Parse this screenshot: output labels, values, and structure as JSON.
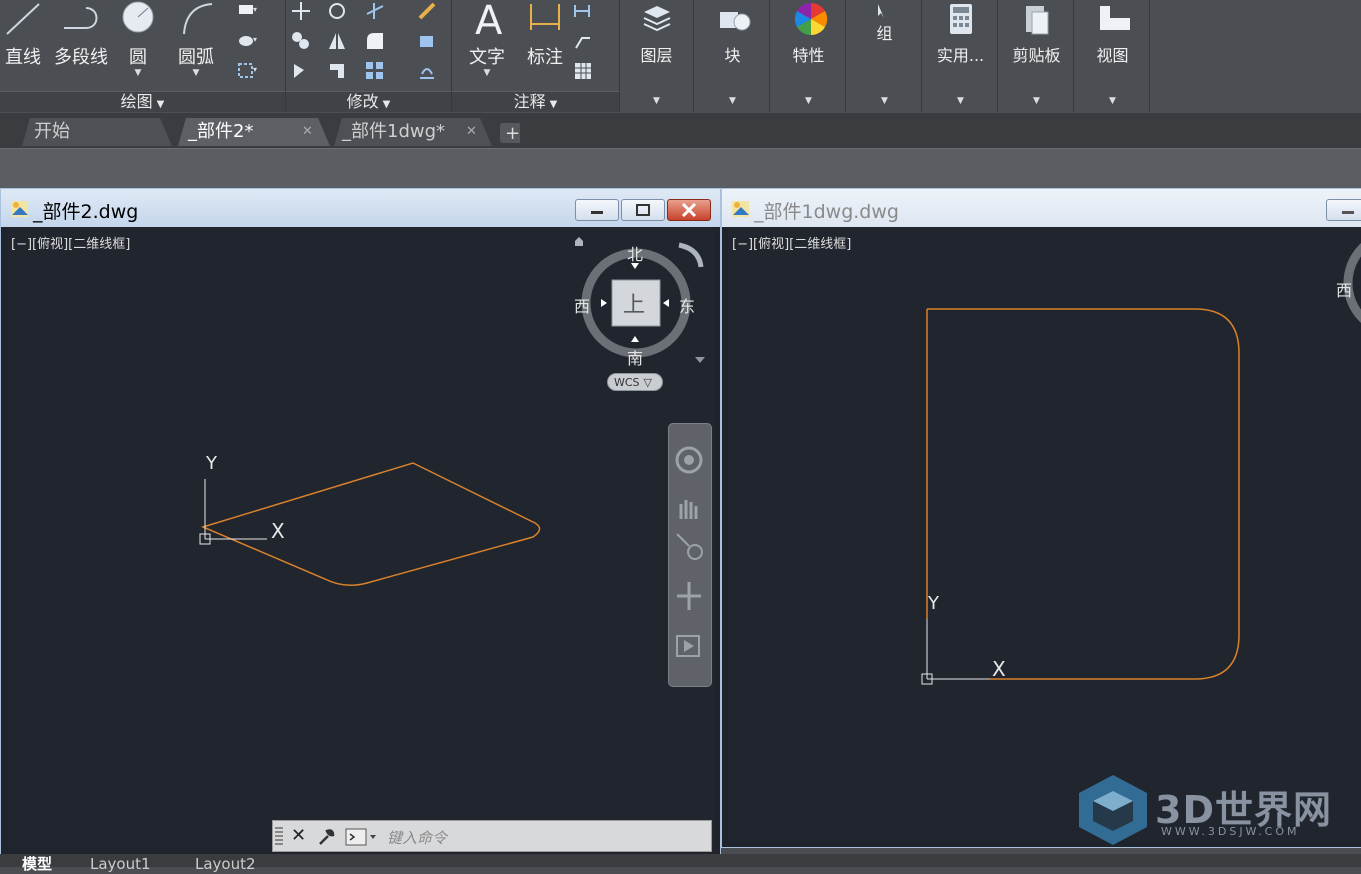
{
  "ribbon": {
    "draw": {
      "line": "直线",
      "polyline": "多段线",
      "circle": "圆",
      "arc": "圆弧",
      "panel_title": "绘图"
    },
    "modify": {
      "panel_title": "修改"
    },
    "annotation": {
      "text": "文字",
      "dimension": "标注",
      "panel_title": "注释"
    },
    "layers": "图层",
    "block": "块",
    "properties": "特性",
    "groups": "组",
    "utilities": "实用...",
    "clipboard": "剪贴板",
    "view": "视图"
  },
  "file_tabs": [
    {
      "label": "开始"
    },
    {
      "label": "_部件2*"
    },
    {
      "label": "_部件1dwg*"
    }
  ],
  "windows": {
    "left": {
      "title": "_部件2.dwg",
      "viewport_label": "[−][俯视][二维线框]",
      "viewcube": {
        "north": "北",
        "south": "南",
        "east": "东",
        "west": "西",
        "face": "上",
        "ucs": "WCS"
      },
      "axis_x": "X",
      "axis_y": "Y"
    },
    "right": {
      "title": "_部件1dwg.dwg",
      "viewport_label": "[−][俯视][二维线框]",
      "viewcube": {
        "west": "西"
      },
      "axis_x": "X",
      "axis_y": "Y"
    }
  },
  "command_line": {
    "placeholder": "键入命令"
  },
  "layout_tabs": {
    "model": "模型",
    "layout1": "Layout1",
    "layout2": "Layout2"
  },
  "watermark": {
    "brand": "3D世界网",
    "url": "WWW.3DSJW.COM"
  },
  "colors": {
    "canvas": "#21252e",
    "geometry": "#d9822b",
    "ribbon": "#4b4e53"
  }
}
